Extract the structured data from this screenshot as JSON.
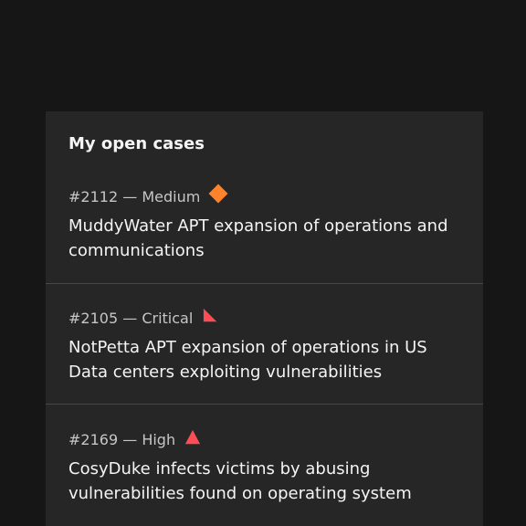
{
  "card": {
    "title": "My open cases"
  },
  "cases": [
    {
      "id": "#2112",
      "separator": "—",
      "severity": "Medium",
      "severity_icon": "medium-severity-diamond-icon",
      "severity_color": "#ff832b",
      "title": "MuddyWater APT expansion of operations and communications"
    },
    {
      "id": "#2105",
      "separator": "—",
      "severity": "Critical",
      "severity_icon": "critical-severity-corner-triangle-icon",
      "severity_color": "#fa4d56",
      "title": "NotPetta APT expansion of operations in US Data centers exploiting vulnerabilities"
    },
    {
      "id": "#2169",
      "separator": "—",
      "severity": "High",
      "severity_icon": "high-severity-triangle-icon",
      "severity_color": "#fa4d56",
      "title": "CosyDuke infects victims by abusing vulnerabilities found on operating system"
    }
  ]
}
